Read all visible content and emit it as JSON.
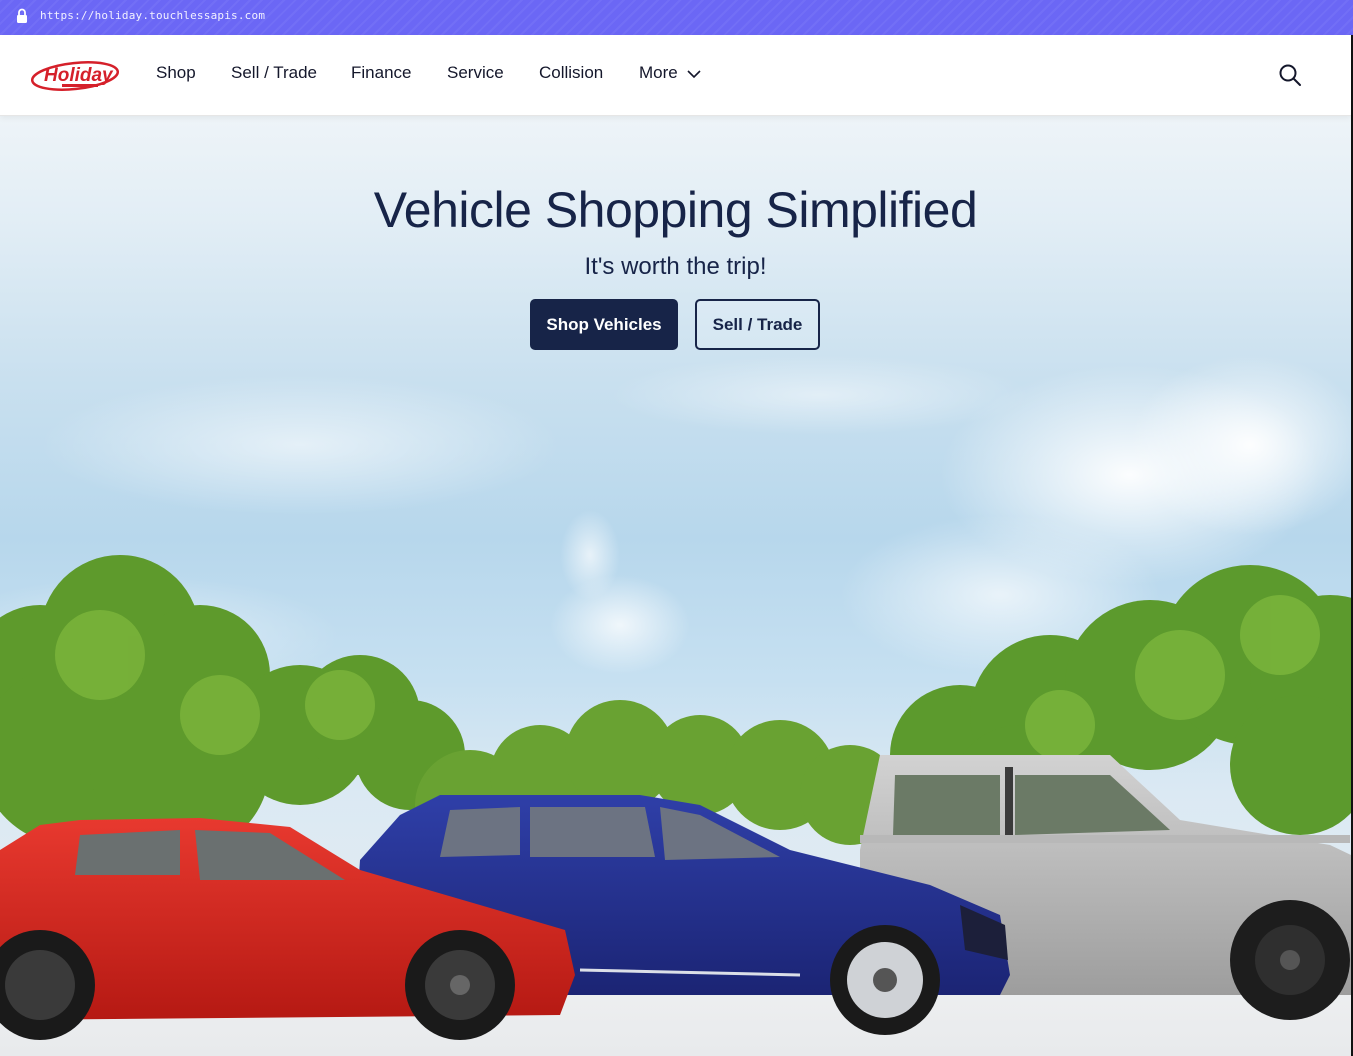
{
  "browser": {
    "url": "https://holiday.touchlessapis.com"
  },
  "header": {
    "logo_text": "Holiday",
    "nav": [
      {
        "label": "Shop"
      },
      {
        "label": "Sell / Trade"
      },
      {
        "label": "Finance"
      },
      {
        "label": "Service"
      },
      {
        "label": "Collision"
      },
      {
        "label": "More"
      }
    ]
  },
  "hero": {
    "title": "Vehicle Shopping Simplified",
    "subtitle": "It's worth the trip!",
    "primary_button": "Shop Vehicles",
    "secondary_button": "Sell / Trade"
  },
  "colors": {
    "brand_navy": "#172448",
    "url_bar": "#6b67f5",
    "logo_red": "#d5202a"
  }
}
